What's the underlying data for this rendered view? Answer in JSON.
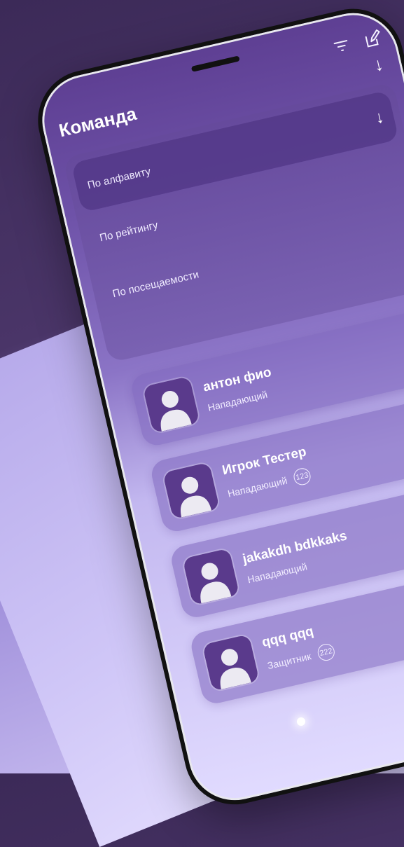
{
  "header": {
    "title": "Команда",
    "filter_icon": "filter-icon",
    "edit_icon": "edit-icon",
    "sort_icon": "arrow-down-icon"
  },
  "sort_menu": {
    "items": [
      {
        "label": "По алфавиту",
        "active": true
      },
      {
        "label": "По рейтингу",
        "active": false
      },
      {
        "label": "По посещаемости",
        "active": false
      }
    ]
  },
  "players": [
    {
      "name": "антон фио",
      "position": "Нападающий",
      "number": ""
    },
    {
      "name": "Игрок Тестер",
      "position": "Нападающий",
      "number": "123"
    },
    {
      "name": "jakakdh bdkkaks",
      "position": "Нападающий",
      "number": ""
    },
    {
      "name": "qqq qqq",
      "position": "Защитник",
      "number": "222"
    }
  ],
  "colors": {
    "accent": "#5e3f93",
    "card": "#8068be",
    "text": "#ffffff"
  }
}
